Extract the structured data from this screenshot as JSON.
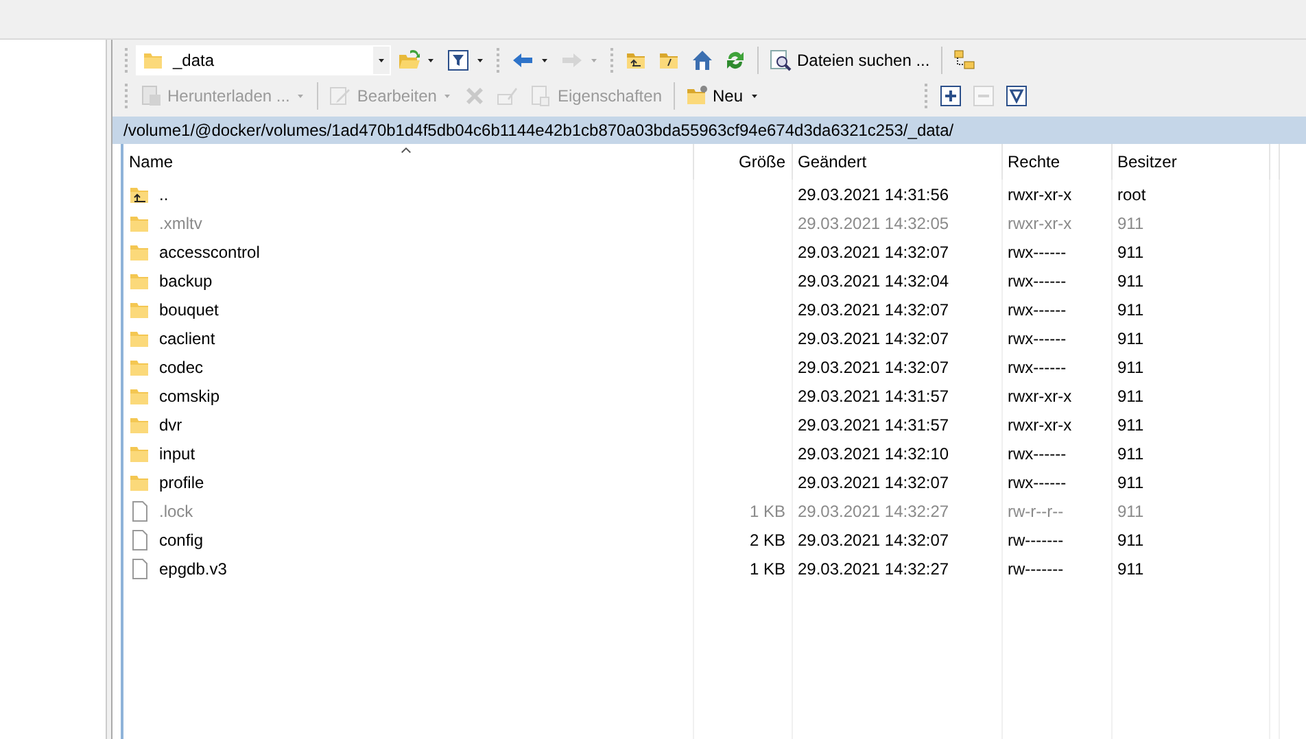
{
  "path_box": {
    "value": "_data"
  },
  "toolbar_top": [
    {
      "kind": "open-folder",
      "dropdown": true,
      "disabled": false
    },
    {
      "kind": "filter",
      "dropdown": true,
      "disabled": false
    },
    {
      "kind": "back",
      "dropdown": true,
      "disabled": false
    },
    {
      "kind": "forward",
      "dropdown": true,
      "disabled": true
    },
    {
      "kind": "parent-folder",
      "dropdown": false,
      "disabled": false
    },
    {
      "kind": "root-folder",
      "dropdown": false,
      "disabled": false
    },
    {
      "kind": "home",
      "dropdown": false,
      "disabled": false
    },
    {
      "kind": "refresh",
      "dropdown": false,
      "disabled": false
    },
    {
      "kind": "find",
      "label": "Dateien suchen ...",
      "dropdown": false,
      "disabled": false
    },
    {
      "kind": "tree",
      "dropdown": false,
      "disabled": false
    }
  ],
  "toolbar_bottom": [
    {
      "kind": "download",
      "label": "Herunterladen ...",
      "dropdown": true,
      "disabled": true
    },
    {
      "kind": "edit",
      "label": "Bearbeiten",
      "dropdown": true,
      "disabled": true
    },
    {
      "kind": "delete",
      "dropdown": false,
      "disabled": true
    },
    {
      "kind": "rename",
      "dropdown": false,
      "disabled": true
    },
    {
      "kind": "properties",
      "label": "Eigenschaften",
      "dropdown": false,
      "disabled": true
    },
    {
      "kind": "new",
      "label": "Neu",
      "dropdown": true,
      "disabled": false
    },
    {
      "kind": "select",
      "dropdown": false,
      "disabled": false
    },
    {
      "kind": "unselect",
      "dropdown": false,
      "disabled": true
    },
    {
      "kind": "filter-select",
      "dropdown": false,
      "disabled": false
    }
  ],
  "path_bar": "/volume1/@docker/volumes/1ad470b1d4f5db04c6b1144e42b1cb870a03bda55963cf94e674d3da6321c253/_data/",
  "table": {
    "columns": [
      "Name",
      "Größe",
      "Geändert",
      "Rechte",
      "Besitzer"
    ],
    "rows": [
      {
        "kind": "parent",
        "hidden": false,
        "name": "..",
        "size": "",
        "modified": "29.03.2021 14:31:56",
        "rights": "rwxr-xr-x",
        "owner": "root"
      },
      {
        "kind": "folder",
        "hidden": true,
        "name": ".xmltv",
        "size": "",
        "modified": "29.03.2021 14:32:05",
        "rights": "rwxr-xr-x",
        "owner": "911"
      },
      {
        "kind": "folder",
        "hidden": false,
        "name": "accesscontrol",
        "size": "",
        "modified": "29.03.2021 14:32:07",
        "rights": "rwx------",
        "owner": "911"
      },
      {
        "kind": "folder",
        "hidden": false,
        "name": "backup",
        "size": "",
        "modified": "29.03.2021 14:32:04",
        "rights": "rwx------",
        "owner": "911"
      },
      {
        "kind": "folder",
        "hidden": false,
        "name": "bouquet",
        "size": "",
        "modified": "29.03.2021 14:32:07",
        "rights": "rwx------",
        "owner": "911"
      },
      {
        "kind": "folder",
        "hidden": false,
        "name": "caclient",
        "size": "",
        "modified": "29.03.2021 14:32:07",
        "rights": "rwx------",
        "owner": "911"
      },
      {
        "kind": "folder",
        "hidden": false,
        "name": "codec",
        "size": "",
        "modified": "29.03.2021 14:32:07",
        "rights": "rwx------",
        "owner": "911"
      },
      {
        "kind": "folder",
        "hidden": false,
        "name": "comskip",
        "size": "",
        "modified": "29.03.2021 14:31:57",
        "rights": "rwxr-xr-x",
        "owner": "911"
      },
      {
        "kind": "folder",
        "hidden": false,
        "name": "dvr",
        "size": "",
        "modified": "29.03.2021 14:31:57",
        "rights": "rwxr-xr-x",
        "owner": "911"
      },
      {
        "kind": "folder",
        "hidden": false,
        "name": "input",
        "size": "",
        "modified": "29.03.2021 14:32:10",
        "rights": "rwx------",
        "owner": "911"
      },
      {
        "kind": "folder",
        "hidden": false,
        "name": "profile",
        "size": "",
        "modified": "29.03.2021 14:32:07",
        "rights": "rwx------",
        "owner": "911"
      },
      {
        "kind": "file",
        "hidden": true,
        "name": ".lock",
        "size": "1 KB",
        "modified": "29.03.2021 14:32:27",
        "rights": "rw-r--r--",
        "owner": "911"
      },
      {
        "kind": "file",
        "hidden": false,
        "name": "config",
        "size": "2 KB",
        "modified": "29.03.2021 14:32:07",
        "rights": "rw-------",
        "owner": "911"
      },
      {
        "kind": "file",
        "hidden": false,
        "name": "epgdb.v3",
        "size": "1 KB",
        "modified": "29.03.2021 14:32:27",
        "rights": "rw-------",
        "owner": "911"
      }
    ]
  }
}
